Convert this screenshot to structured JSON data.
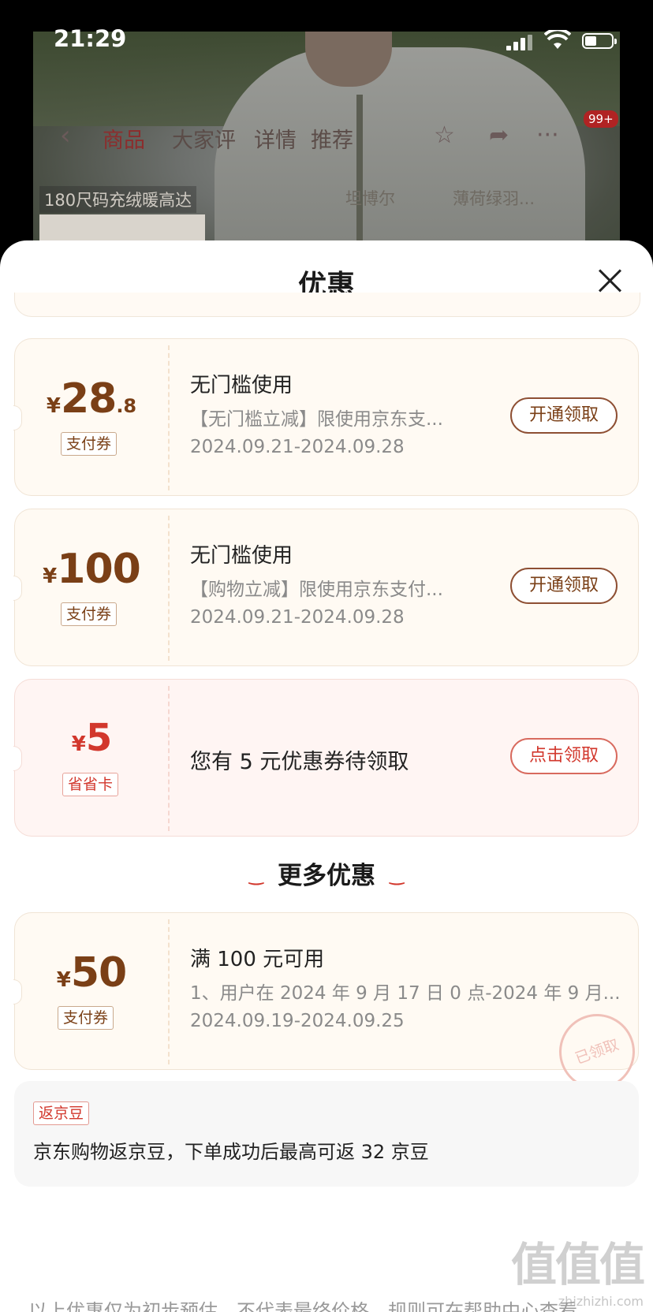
{
  "status_bar": {
    "time": "21:29"
  },
  "background_page": {
    "tabs": [
      "商品",
      "大家评",
      "详情",
      "推荐"
    ],
    "badge": "99+",
    "tags": [
      "180尺码充绒暖高达",
      "坦博尔",
      "薄荷绿羽..."
    ]
  },
  "sheet": {
    "title": "优惠",
    "coupons": [
      {
        "yen": "¥",
        "amount": "28",
        "decimal": ".8",
        "type": "支付券",
        "title": "无门槛使用",
        "desc": "【无门槛立减】限使用京东支...",
        "date": "2024.09.21-2024.09.28",
        "button": "开通领取"
      },
      {
        "yen": "¥",
        "amount": "100",
        "decimal": "",
        "type": "支付券",
        "title": "无门槛使用",
        "desc": "【购物立减】限使用京东支付...",
        "date": "2024.09.21-2024.09.28",
        "button": "开通领取"
      }
    ],
    "saver_card": {
      "yen": "¥",
      "amount": "5",
      "type": "省省卡",
      "text": "您有 5 元优惠券待领取",
      "button": "点击领取"
    },
    "more_title": "更多优惠",
    "more_coupon": {
      "yen": "¥",
      "amount": "50",
      "type": "支付券",
      "title": "满 100 元可用",
      "desc": "1、用户在 2024 年 9 月 17 日 0 点-2024 年 9 月...",
      "date": "2024.09.19-2024.09.25",
      "stamp": "已领取"
    },
    "bean": {
      "tag": "返京豆",
      "text": "京东购物返京豆，下单成功后最高可返 32 京豆"
    },
    "footer_note": "以上优惠仅为初步预估，不代表最终价格，规则可在帮助中心查看"
  },
  "watermark": {
    "big": "值值值",
    "small": "zhizhizhi.com"
  }
}
